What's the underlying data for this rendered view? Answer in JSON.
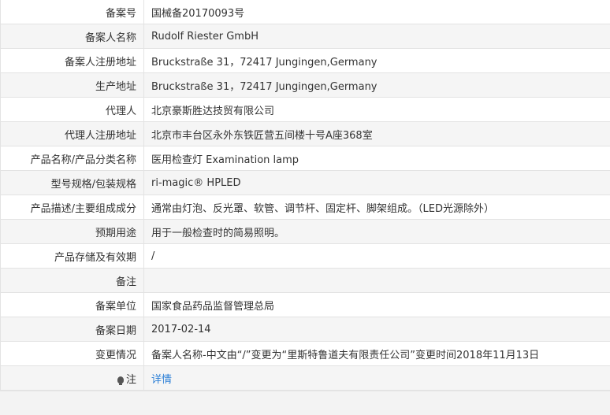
{
  "rows": [
    {
      "label": "备案号",
      "value": "国械备20170093号"
    },
    {
      "label": "备案人名称",
      "value": "Rudolf Riester GmbH"
    },
    {
      "label": "备案人注册地址",
      "value": "Bruckstraße 31，72417 Jungingen,Germany"
    },
    {
      "label": "生产地址",
      "value": "Bruckstraße 31，72417 Jungingen,Germany"
    },
    {
      "label": "代理人",
      "value": "北京豪斯胜达技贸有限公司"
    },
    {
      "label": "代理人注册地址",
      "value": "北京市丰台区永外东铁匠营五间楼十号A座368室"
    },
    {
      "label": "产品名称/产品分类名称",
      "value": "医用检查灯 Examination lamp"
    },
    {
      "label": "型号规格/包装规格",
      "value": "ri-magic® HPLED"
    },
    {
      "label": "产品描述/主要组成成分",
      "value": "通常由灯泡、反光罩、软管、调节杆、固定杆、脚架组成。（LED光源除外）"
    },
    {
      "label": "预期用途",
      "value": "用于一般检查时的简易照明。"
    },
    {
      "label": "产品存储及有效期",
      "value": "/"
    },
    {
      "label": "备注",
      "value": ""
    },
    {
      "label": "备案单位",
      "value": "国家食品药品监督管理总局"
    },
    {
      "label": "备案日期",
      "value": "2017-02-14"
    },
    {
      "label": "变更情况",
      "value": "备案人名称-中文由“/”变更为“里斯特鲁道夫有限责任公司”变更时间2018年11月13日"
    }
  ],
  "note": {
    "label": "注",
    "link": "详情",
    "icon": "lightbulb-icon"
  }
}
